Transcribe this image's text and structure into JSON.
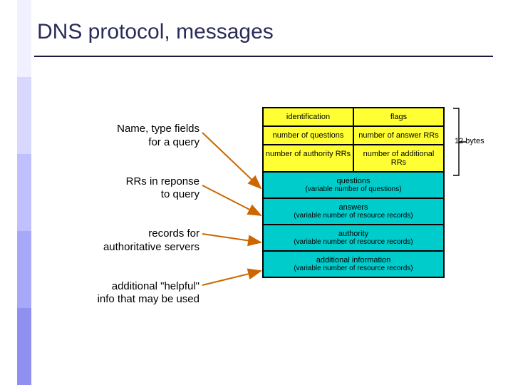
{
  "accent_colors": [
    "#f0f0ff",
    "#d8d8ff",
    "#c0c0ff",
    "#a8a8f8",
    "#9090f0"
  ],
  "title": "DNS protocol, messages",
  "labels": {
    "l1a": "Name, type fields",
    "l1b": "for a query",
    "l2a": "RRs in reponse",
    "l2b": "to query",
    "l3a": "records for",
    "l3b": "authoritative servers",
    "l4a": "additional \"helpful\"",
    "l4b": "info that may be used"
  },
  "header": {
    "r1c1": "identification",
    "r1c2": "flags",
    "r2c1": "number of questions",
    "r2c2": "number of answer RRs",
    "r3c1": "number of authority RRs",
    "r3c2": "number of additional RRs"
  },
  "body": {
    "q_t": "questions",
    "q_s": "(variable number of questions)",
    "a_t": "answers",
    "a_s": "(variable number of resource records)",
    "au_t": "authority",
    "au_s": "(variable number of resource records)",
    "ad_t": "additional information",
    "ad_s": "(variable number of resource records)"
  },
  "bracket_label": "12 bytes",
  "arrow_color": "#cc6600"
}
